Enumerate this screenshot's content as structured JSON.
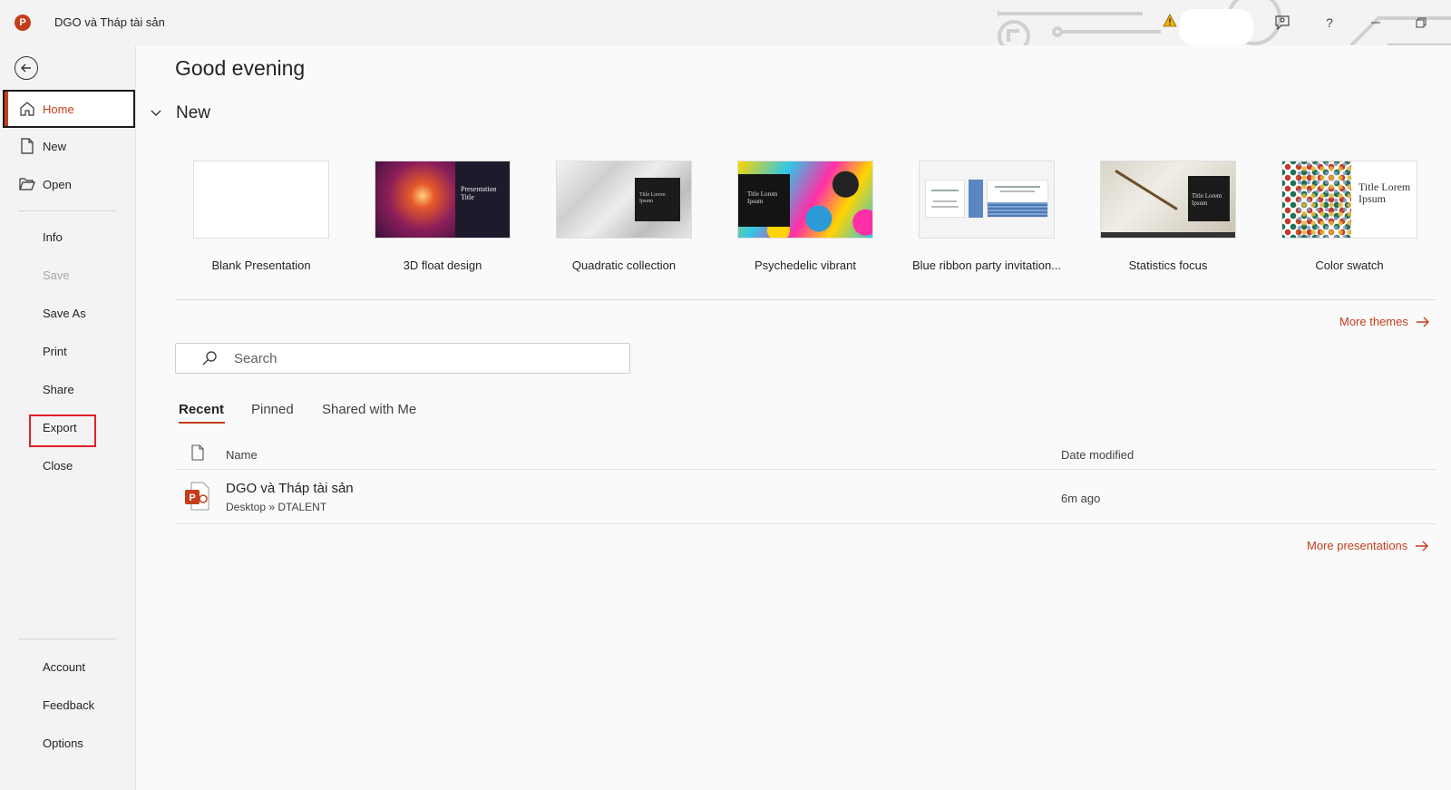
{
  "titlebar": {
    "doc_title": "DGO và Tháp tài sản",
    "app_initial": "P",
    "help": "?"
  },
  "sidebar": {
    "items": [
      {
        "label": "Home"
      },
      {
        "label": "New"
      },
      {
        "label": "Open"
      },
      {
        "label": "Info"
      },
      {
        "label": "Save"
      },
      {
        "label": "Save As"
      },
      {
        "label": "Print"
      },
      {
        "label": "Share"
      },
      {
        "label": "Export"
      },
      {
        "label": "Close"
      }
    ],
    "bottom_items": [
      {
        "label": "Account"
      },
      {
        "label": "Feedback"
      },
      {
        "label": "Options"
      }
    ]
  },
  "main": {
    "greeting": "Good evening",
    "new_section": "New",
    "templates": [
      {
        "label": "Blank Presentation"
      },
      {
        "label": "3D float design",
        "thumb_text": "Presentation Title"
      },
      {
        "label": "Quadratic collection",
        "thumb_text": "Title Lorem Ipsum"
      },
      {
        "label": "Psychedelic vibrant",
        "thumb_text": "Title Lorem Ipsum"
      },
      {
        "label": "Blue ribbon party invitation..."
      },
      {
        "label": "Statistics focus",
        "thumb_text": "Title Lorem Ipsum"
      },
      {
        "label": "Color swatch",
        "thumb_text": "Title Lorem Ipsum"
      }
    ],
    "more_themes": "More themes",
    "search_placeholder": "Search",
    "tabs": [
      {
        "label": "Recent"
      },
      {
        "label": "Pinned"
      },
      {
        "label": "Shared with Me"
      }
    ],
    "columns": {
      "name": "Name",
      "date": "Date modified"
    },
    "files": [
      {
        "name": "DGO và Tháp tài sản",
        "path": "Desktop » DTALENT",
        "date": "6m ago"
      }
    ],
    "more_presentations": "More presentations"
  },
  "colors": {
    "accent": "#c43e1c",
    "highlight": "#e0202a"
  }
}
